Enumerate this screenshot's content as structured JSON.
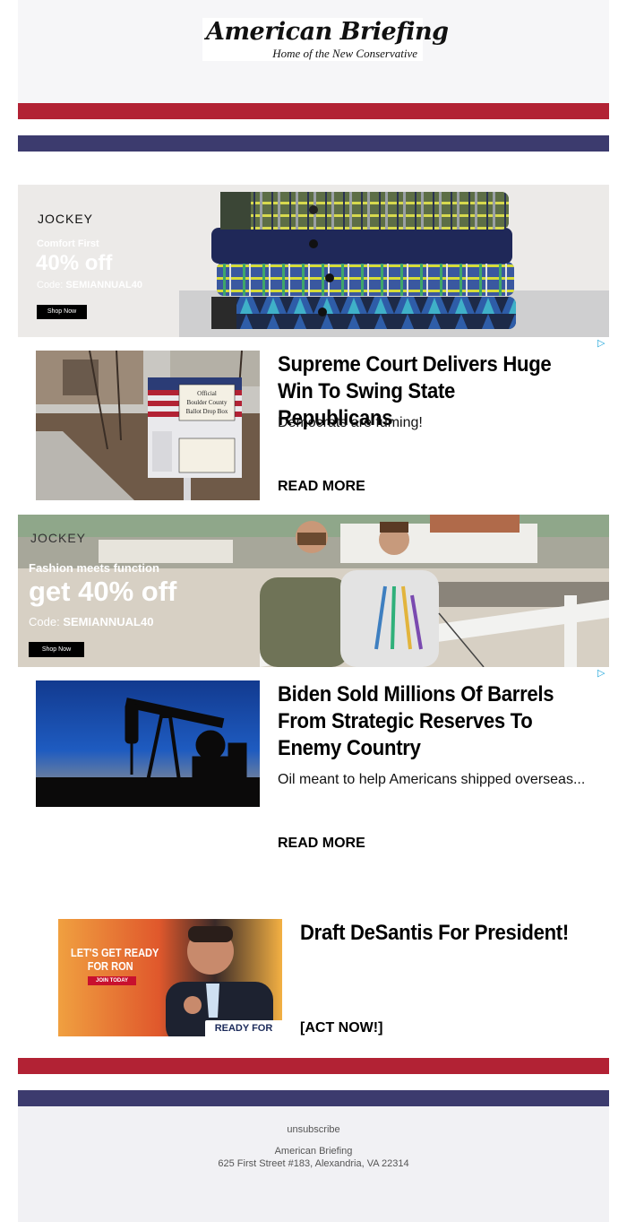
{
  "header": {
    "title": "American Briefing",
    "subtitle": "Home of the New Conservative"
  },
  "ad1": {
    "brand": "JOCKEY",
    "tagline": "Comfort First",
    "offer": "40% off",
    "code_label": "Code: ",
    "code": "SEMIANNUAL40",
    "button": "Shop Now"
  },
  "article1": {
    "headline": "Supreme Court Delivers Huge Win To Swing State Republicans",
    "dek": "Democrats are fuming!",
    "cta": "READ MORE",
    "image_sign_lines": [
      "Official",
      "Boulder County",
      "Ballot Drop Box"
    ]
  },
  "ad2": {
    "brand": "JOCKEY",
    "tagline": "Fashion meets function",
    "offer": "get 40% off",
    "code_label": "Code: ",
    "code": "SEMIANNUAL40",
    "button": "Shop Now"
  },
  "article2": {
    "headline": "Biden Sold Millions Of Barrels From Strategic Reserves To Enemy Country",
    "dek": "Oil meant to help Americans shipped overseas...",
    "cta": "READ MORE"
  },
  "promo": {
    "headline": "Draft DeSantis For President!",
    "cta": "[ACT NOW!]",
    "image_text_1": "LET'S GET READY",
    "image_text_2": "FOR RON",
    "image_button": "JOIN TODAY",
    "image_badge": "READY FOR RON"
  },
  "footer": {
    "unsubscribe": "unsubscribe",
    "org": "American Briefing",
    "address": "625 First Street #183, Alexandria, VA 22314"
  },
  "icons": {
    "adchoices": "adchoices-icon"
  },
  "colors": {
    "red": "#b22234",
    "blue": "#3c3b6e"
  }
}
